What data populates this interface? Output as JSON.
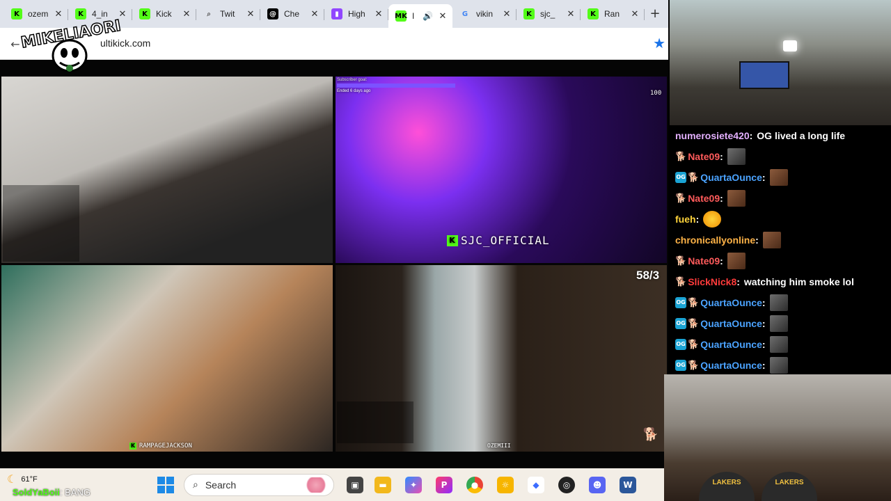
{
  "browser": {
    "tabs": [
      {
        "title": "ozem",
        "favicon": "kick-icon",
        "color": "#53fc18",
        "active": false
      },
      {
        "title": "4_in",
        "favicon": "kick-icon",
        "color": "#53fc18",
        "active": false
      },
      {
        "title": "Kick",
        "favicon": "kick-icon",
        "color": "#53fc18",
        "active": false
      },
      {
        "title": "Twit",
        "favicon": "search-icon",
        "color": "#555555",
        "active": false
      },
      {
        "title": "Che",
        "favicon": "threads-icon",
        "color": "#000000",
        "active": false
      },
      {
        "title": "High",
        "favicon": "twitch-icon",
        "color": "#9146ff",
        "active": false
      },
      {
        "title": "I",
        "favicon": "multikick-icon",
        "color": "#53fc18",
        "active": true
      },
      {
        "title": "vikin",
        "favicon": "google-icon",
        "color": "#4285f4",
        "active": false
      },
      {
        "title": "sjc_",
        "favicon": "kick-icon",
        "color": "#53fc18",
        "active": false
      },
      {
        "title": "Ran",
        "favicon": "kick-icon",
        "color": "#53fc18",
        "active": false
      }
    ],
    "url": "ultikick.com",
    "streams": {
      "sjc_label": "SJC_OFFICIAL",
      "rampage_label": "RAMPAGEJACKSON",
      "ozemiii_label": "OZEMIII",
      "ratio": "58/3",
      "subscriber_goal": "Subscriber goal:",
      "ended": "Ended 6 days ago",
      "number": "100"
    }
  },
  "overlay": {
    "logo_text": "MIKELIAORI",
    "username": "SoldYaBoii",
    "message": ": BANG"
  },
  "taskbar": {
    "temperature": "61°F",
    "search_placeholder": "Search"
  },
  "chat": {
    "messages": [
      {
        "user": "numerosiete420",
        "color": "#e4b0ff",
        "badges": [],
        "text": "OG lived a long life",
        "emote": ""
      },
      {
        "user": "Nate09",
        "color": "#ff5b5b",
        "badges": [
          "dog"
        ],
        "text": "",
        "emote": "gray"
      },
      {
        "user": "QuartaOunce",
        "color": "#4ba3ff",
        "badges": [
          "og",
          "dog"
        ],
        "text": "",
        "emote": "brown"
      },
      {
        "user": "Nate09",
        "color": "#ff5b5b",
        "badges": [
          "dog"
        ],
        "text": "",
        "emote": "brown"
      },
      {
        "user": "fueh",
        "color": "#ffd43b",
        "badges": [],
        "text": "",
        "emote": "yellow"
      },
      {
        "user": "chronicallyonline",
        "color": "#ffb347",
        "badges": [],
        "text": "",
        "emote": "brown"
      },
      {
        "user": "Nate09",
        "color": "#ff5b5b",
        "badges": [
          "dog"
        ],
        "text": "",
        "emote": "brown"
      },
      {
        "user": "SlickNick8",
        "color": "#ff3b3b",
        "badges": [
          "dog"
        ],
        "text": "watching him smoke lol",
        "emote": ""
      },
      {
        "user": "QuartaOunce",
        "color": "#4ba3ff",
        "badges": [
          "og",
          "dog"
        ],
        "text": "",
        "emote": "gray"
      },
      {
        "user": "QuartaOunce",
        "color": "#4ba3ff",
        "badges": [
          "og",
          "dog"
        ],
        "text": "",
        "emote": "gray"
      },
      {
        "user": "QuartaOunce",
        "color": "#4ba3ff",
        "badges": [
          "og",
          "dog"
        ],
        "text": "",
        "emote": "gray"
      },
      {
        "user": "QuartaOunce",
        "color": "#4ba3ff",
        "badges": [
          "og",
          "dog"
        ],
        "text": "",
        "emote": "gray"
      }
    ]
  },
  "webcam": {
    "lakers_label": "LAKERS"
  }
}
